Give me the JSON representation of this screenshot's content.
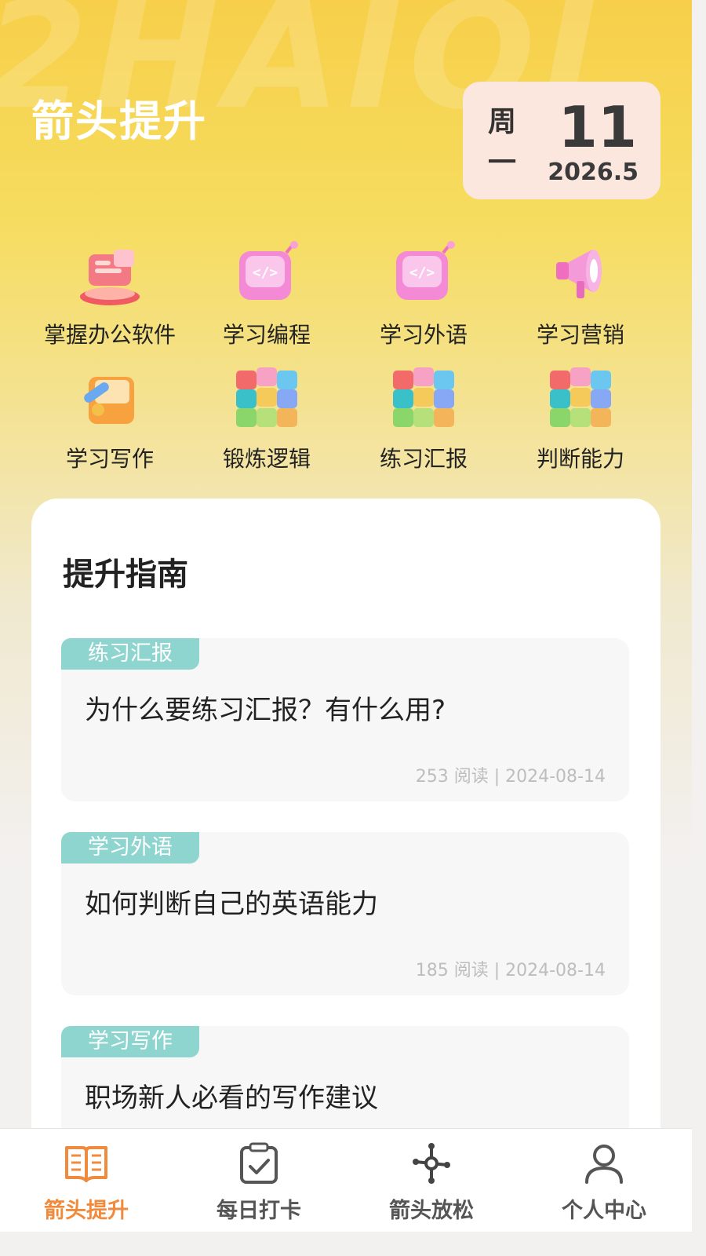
{
  "header": {
    "watermark": "2HAIOI",
    "title": "箭头提升",
    "date": {
      "week_top": "周",
      "week_bottom": "一",
      "day": "11",
      "year_month": "2026.5"
    }
  },
  "categories": [
    {
      "label": "掌握办公软件",
      "icon": "office-icon"
    },
    {
      "label": "学习编程",
      "icon": "code-icon"
    },
    {
      "label": "学习外语",
      "icon": "code-icon"
    },
    {
      "label": "学习营销",
      "icon": "megaphone-icon"
    },
    {
      "label": "学习写作",
      "icon": "writing-icon"
    },
    {
      "label": "锻炼逻辑",
      "icon": "cube-icon"
    },
    {
      "label": "练习汇报",
      "icon": "cube-icon"
    },
    {
      "label": "判断能力",
      "icon": "cube-icon"
    }
  ],
  "guide": {
    "title": "提升指南",
    "articles": [
      {
        "tag": "练习汇报",
        "title": "为什么要练习汇报？有什么用?",
        "meta": "253 阅读 | 2024-08-14"
      },
      {
        "tag": "学习外语",
        "title": "如何判断自己的英语能力",
        "meta": "185 阅读 | 2024-08-14"
      },
      {
        "tag": "学习写作",
        "title": "职场新人必看的写作建议",
        "meta": ""
      }
    ]
  },
  "tabbar": {
    "tabs": [
      {
        "label": "箭头提升",
        "icon": "book-icon",
        "active": true
      },
      {
        "label": "每日打卡",
        "icon": "checkin-icon",
        "active": false
      },
      {
        "label": "箭头放松",
        "icon": "relax-icon",
        "active": false
      },
      {
        "label": "个人中心",
        "icon": "profile-icon",
        "active": false
      }
    ]
  },
  "colors": {
    "accent": "#f08a3c",
    "tag_bg": "#8fd5cf",
    "date_card": "#fbe7de"
  }
}
